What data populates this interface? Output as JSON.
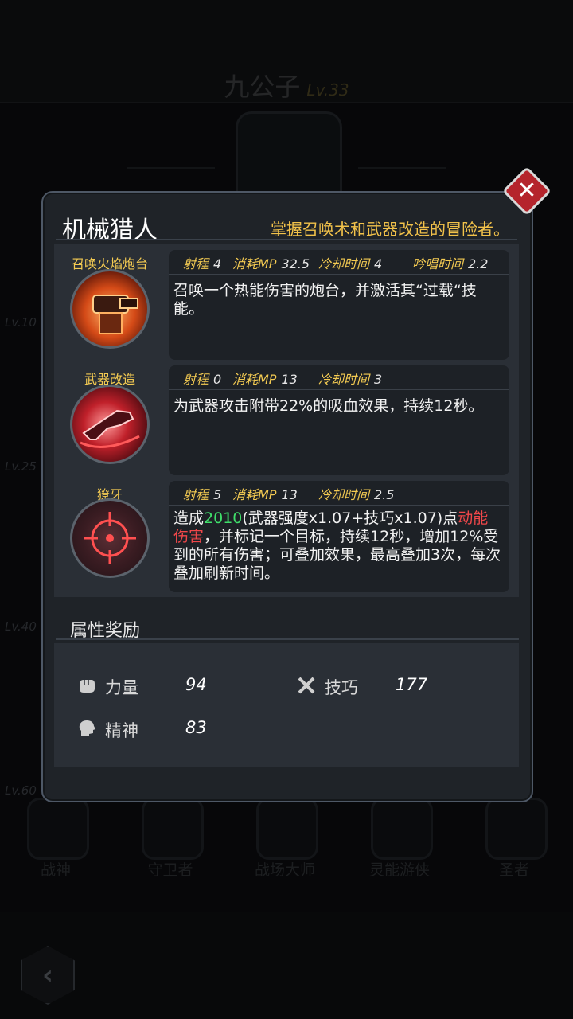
{
  "background": {
    "character_name": "九公子",
    "character_level": "Lv.33",
    "level_markers": [
      "Lv.10",
      "Lv.25",
      "Lv.40",
      "Lv.60"
    ],
    "classes": [
      "战神",
      "守卫者",
      "战场大师",
      "灵能游侠",
      "圣者"
    ]
  },
  "modal": {
    "class_name": "机械猎人",
    "class_description": "掌握召唤术和武器改造的冒险者。",
    "skills": [
      {
        "name": "召唤火焰炮台",
        "icon": "turret-icon",
        "stats": [
          {
            "label": "射程",
            "value": "4"
          },
          {
            "label": "消耗MP",
            "value": "32.5"
          },
          {
            "label": "冷却时间",
            "value": "4"
          },
          {
            "label": "吟唱时间",
            "value": "2.2"
          }
        ],
        "description": "召唤一个热能伤害的炮台，并激活其“过载“技能。"
      },
      {
        "name": "武器改造",
        "icon": "weapon-mod-icon",
        "stats": [
          {
            "label": "射程",
            "value": "0"
          },
          {
            "label": "消耗MP",
            "value": "13"
          },
          {
            "label": "冷却时间",
            "value": "3"
          }
        ],
        "description": "为武器攻击附带22%的吸血效果，持续12秒。"
      },
      {
        "name": "獠牙",
        "icon": "crosshair-icon",
        "stats": [
          {
            "label": "射程",
            "value": "5"
          },
          {
            "label": "消耗MP",
            "value": "13"
          },
          {
            "label": "冷却时间",
            "value": "2.5"
          }
        ],
        "description_parts": {
          "prefix": "造成",
          "damage": "2010",
          "formula": "(武器强度x1.07+技巧x1.07)点",
          "damage_type": "动能伤害",
          "suffix": "，并标记一个目标，持续12秒，增加12%受到的所有伤害；可叠加效果，最高叠加3次，每次叠加刷新时间。"
        }
      }
    ],
    "attributes_title": "属性奖励",
    "attributes": [
      {
        "label": "力量",
        "value": "94",
        "icon": "fist-icon"
      },
      {
        "label": "技巧",
        "value": "177",
        "icon": "crossed-tools-icon"
      },
      {
        "label": "精神",
        "value": "83",
        "icon": "head-icon"
      }
    ]
  },
  "colors": {
    "accent_gold": "#f4cb52",
    "damage_green": "#3fdf6a",
    "damage_red": "#f0474a",
    "close_red": "#b5242c"
  }
}
